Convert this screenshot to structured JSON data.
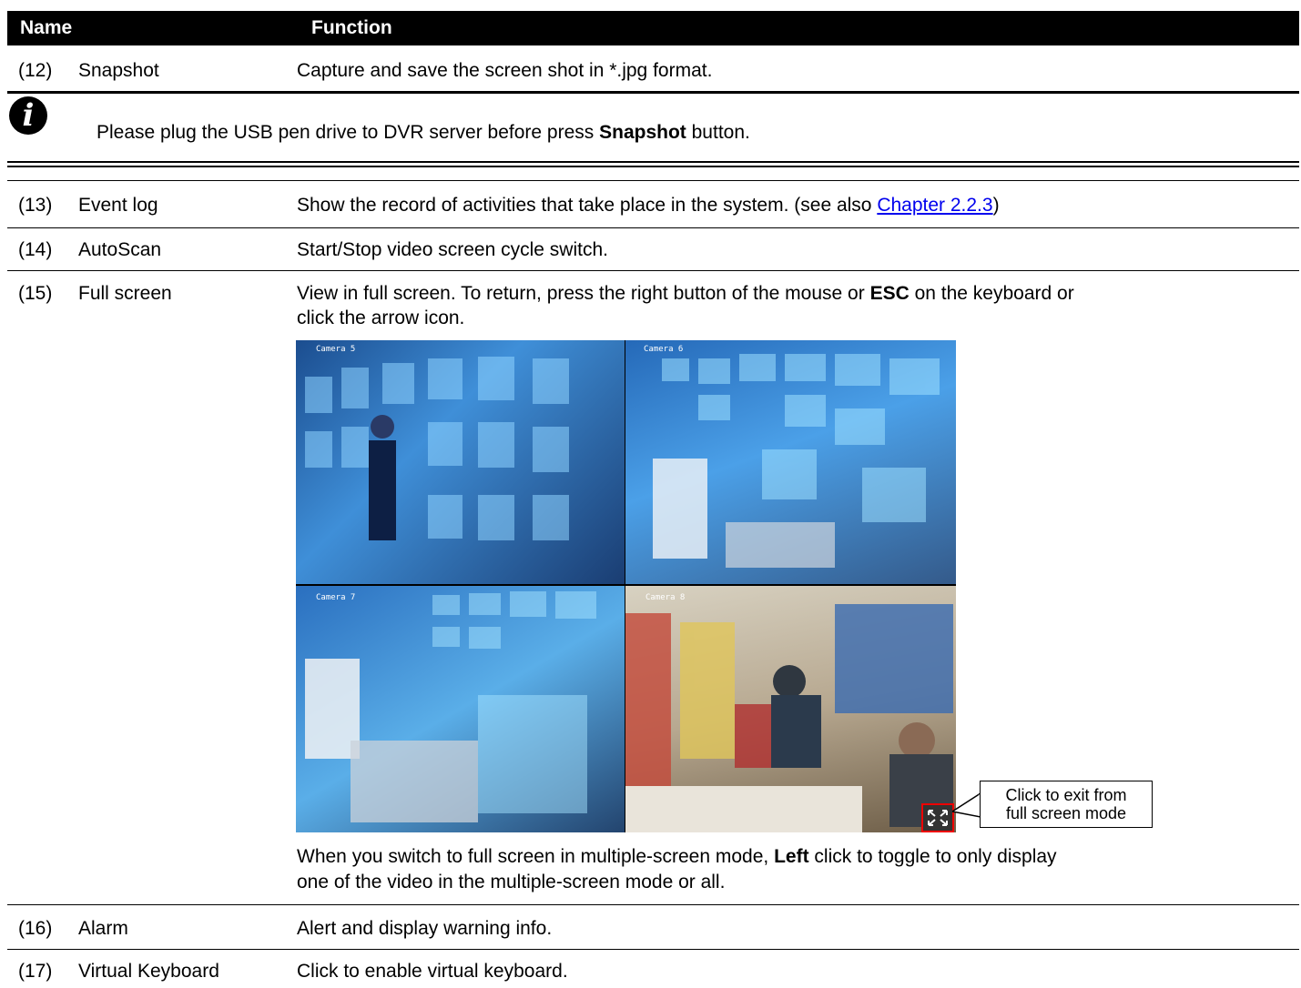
{
  "header": {
    "name": "Name",
    "function": "Function"
  },
  "rows": {
    "r12": {
      "num": "(12)",
      "name": "Snapshot",
      "func": "Capture and save the screen shot in *.jpg format."
    },
    "note": {
      "pre": "Please plug the USB pen drive to DVR server before press ",
      "bold": "Snapshot",
      "post": " button."
    },
    "r13": {
      "num": "(13)",
      "name": "Event log",
      "func_pre": "Show the record of activities that take place in the system. (see also ",
      "link": "Chapter 2.2.3",
      "func_post": ")"
    },
    "r14": {
      "num": "(14)",
      "name": "AutoScan",
      "func": "Start/Stop video screen cycle switch."
    },
    "r15": {
      "num": "(15)",
      "name": "Full screen",
      "func_pre": "View in full screen. To return, press the right button of the mouse or ",
      "func_bold": "ESC",
      "func_mid": " on the keyboard or",
      "func_line2": "click the arrow icon.",
      "after_pre": "When you switch to full screen in multiple-screen mode, ",
      "after_bold": "Left",
      "after_post": " click to toggle to only display",
      "after_line2": "one of the video in the multiple-screen mode or all."
    },
    "r16": {
      "num": "(16)",
      "name": "Alarm",
      "func": "Alert and display warning info."
    },
    "r17": {
      "num": "(17)",
      "name": "Virtual Keyboard",
      "func": "Click to enable virtual keyboard."
    }
  },
  "screenshot": {
    "cameras": [
      "Camera 5",
      "Camera 6",
      "Camera 7",
      "Camera 8"
    ],
    "callout_line1": "Click to exit from",
    "callout_line2": "full screen mode"
  }
}
